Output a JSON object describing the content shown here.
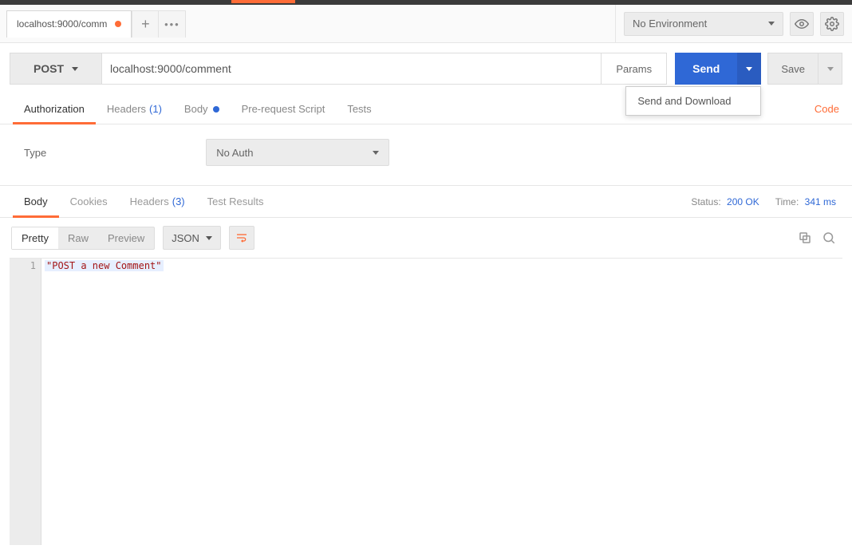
{
  "tabs": {
    "items": [
      {
        "label": "localhost:9000/comm"
      }
    ]
  },
  "environment": {
    "selected": "No Environment"
  },
  "request": {
    "method": "POST",
    "url": "localhost:9000/comment",
    "params_label": "Params",
    "send_label": "Send",
    "save_label": "Save",
    "send_menu": {
      "download": "Send and Download"
    }
  },
  "request_tabs": {
    "authorization": "Authorization",
    "headers": "Headers",
    "headers_count": "(1)",
    "body": "Body",
    "prerequest": "Pre-request Script",
    "tests": "Tests",
    "code_link": "Code"
  },
  "authorization": {
    "type_label": "Type",
    "selected": "No Auth"
  },
  "response_tabs": {
    "body": "Body",
    "cookies": "Cookies",
    "headers": "Headers",
    "headers_count": "(3)",
    "test_results": "Test Results"
  },
  "status": {
    "status_label": "Status:",
    "status_value": "200 OK",
    "time_label": "Time:",
    "time_value": "341 ms"
  },
  "response_toolbar": {
    "pretty": "Pretty",
    "raw": "Raw",
    "preview": "Preview",
    "format": "JSON"
  },
  "response_body": {
    "line_number": "1",
    "content": "\"POST a new Comment\""
  }
}
